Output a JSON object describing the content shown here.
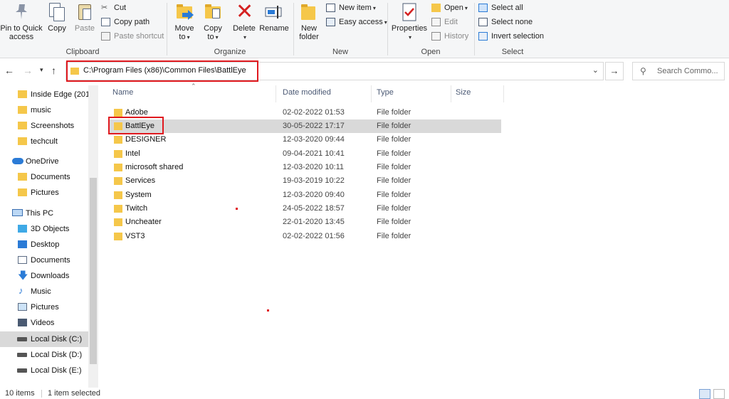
{
  "ribbon": {
    "clipboard": {
      "label": "Clipboard",
      "pin": "Pin to Quick access",
      "pin_line1": "Pin to Quick",
      "pin_line2": "access",
      "copy": "Copy",
      "paste": "Paste",
      "cut": "Cut",
      "copy_path": "Copy path",
      "paste_shortcut": "Paste shortcut"
    },
    "organize": {
      "label": "Organize",
      "move_to": "Move",
      "move_to2": "to",
      "copy_to": "Copy",
      "copy_to2": "to",
      "delete": "Delete",
      "rename": "Rename"
    },
    "new": {
      "label": "New",
      "new_folder": "New",
      "new_folder2": "folder",
      "new_item": "New item",
      "easy_access": "Easy access"
    },
    "open": {
      "label": "Open",
      "properties": "Properties",
      "open": "Open",
      "edit": "Edit",
      "history": "History"
    },
    "select": {
      "label": "Select",
      "select_all": "Select all",
      "select_none": "Select none",
      "invert": "Invert selection"
    }
  },
  "address": {
    "path": "C:\\Program Files (x86)\\Common Files\\BattlEye",
    "search_placeholder": "Search Commo..."
  },
  "nav": {
    "items": [
      {
        "label": "Inside Edge (201",
        "icon": "folder-icon"
      },
      {
        "label": "music",
        "icon": "folder-icon"
      },
      {
        "label": "Screenshots",
        "icon": "folder-icon"
      },
      {
        "label": "techcult",
        "icon": "folder-icon"
      },
      {
        "label": "OneDrive",
        "icon": "cloud-icon"
      },
      {
        "label": "Documents",
        "icon": "folder-icon"
      },
      {
        "label": "Pictures",
        "icon": "folder-icon"
      },
      {
        "label": "This PC",
        "icon": "computer-icon"
      },
      {
        "label": "3D Objects",
        "icon": "cube-icon"
      },
      {
        "label": "Desktop",
        "icon": "desktop-icon"
      },
      {
        "label": "Documents",
        "icon": "documents-icon"
      },
      {
        "label": "Downloads",
        "icon": "download-icon"
      },
      {
        "label": "Music",
        "icon": "music-icon"
      },
      {
        "label": "Pictures",
        "icon": "pictures-icon"
      },
      {
        "label": "Videos",
        "icon": "videos-icon"
      },
      {
        "label": "Local Disk (C:)",
        "icon": "drive-icon"
      },
      {
        "label": "Local Disk (D:)",
        "icon": "drive-icon"
      },
      {
        "label": "Local Disk (E:)",
        "icon": "drive-icon"
      }
    ]
  },
  "columns": {
    "name": "Name",
    "date": "Date modified",
    "type": "Type",
    "size": "Size"
  },
  "files": [
    {
      "name": "Adobe",
      "date": "02-02-2022 01:53",
      "type": "File folder"
    },
    {
      "name": "BattlEye",
      "date": "30-05-2022 17:17",
      "type": "File folder"
    },
    {
      "name": "DESIGNER",
      "date": "12-03-2020 09:44",
      "type": "File folder"
    },
    {
      "name": "Intel",
      "date": "09-04-2021 10:41",
      "type": "File folder"
    },
    {
      "name": "microsoft shared",
      "date": "12-03-2020 10:11",
      "type": "File folder"
    },
    {
      "name": "Services",
      "date": "19-03-2019 10:22",
      "type": "File folder"
    },
    {
      "name": "System",
      "date": "12-03-2020 09:40",
      "type": "File folder"
    },
    {
      "name": "Twitch",
      "date": "24-05-2022 18:57",
      "type": "File folder"
    },
    {
      "name": "Uncheater",
      "date": "22-01-2020 13:45",
      "type": "File folder"
    },
    {
      "name": "VST3",
      "date": "02-02-2022 01:56",
      "type": "File folder"
    }
  ],
  "status": {
    "count": "10 items",
    "selected": "1 item selected"
  }
}
